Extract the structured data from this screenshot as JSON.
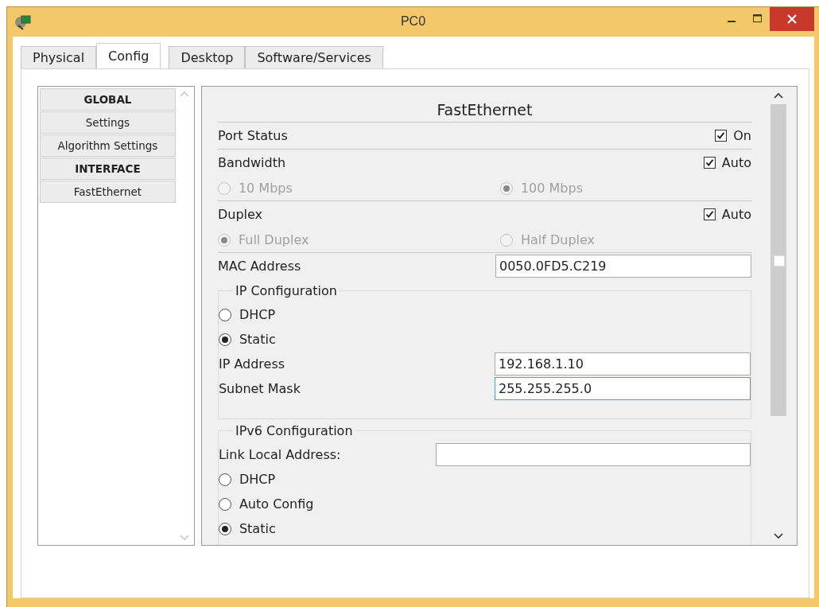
{
  "window": {
    "title": "PC0"
  },
  "tabs": [
    {
      "label": "Physical",
      "selected": false
    },
    {
      "label": "Config",
      "selected": true
    },
    {
      "label": "Desktop",
      "selected": false
    },
    {
      "label": "Software/Services",
      "selected": false
    }
  ],
  "sidebar": {
    "items": [
      {
        "label": "GLOBAL",
        "kind": "header"
      },
      {
        "label": "Settings",
        "kind": "item"
      },
      {
        "label": "Algorithm Settings",
        "kind": "item"
      },
      {
        "label": "INTERFACE",
        "kind": "header"
      },
      {
        "label": "FastEthernet",
        "kind": "item"
      }
    ]
  },
  "panel": {
    "title": "FastEthernet",
    "rows": [
      {
        "kind": "check",
        "label": "Port Status",
        "check_label": "On",
        "checked": true
      },
      {
        "kind": "check",
        "label": "Bandwidth",
        "check_label": "Auto",
        "checked": true
      },
      {
        "kind": "radios",
        "options": [
          {
            "label": "10 Mbps",
            "selected": false,
            "disabled": true
          },
          {
            "label": "100 Mbps",
            "selected": true,
            "disabled": true
          }
        ]
      },
      {
        "kind": "check",
        "label": "Duplex",
        "check_label": "Auto",
        "checked": true
      },
      {
        "kind": "radios",
        "options": [
          {
            "label": "Full Duplex",
            "selected": true,
            "disabled": true
          },
          {
            "label": "Half Duplex",
            "selected": false,
            "disabled": true
          }
        ]
      },
      {
        "kind": "field",
        "label": "MAC Address",
        "value": "0050.0FD5.C219",
        "focused": false
      },
      {
        "kind": "group",
        "title": "IP Configuration",
        "rows": [
          {
            "kind": "radio",
            "label": "DHCP",
            "selected": false
          },
          {
            "kind": "radio",
            "label": "Static",
            "selected": true
          },
          {
            "kind": "field",
            "label": "IP Address",
            "value": "192.168.1.10",
            "focused": false
          },
          {
            "kind": "field",
            "label": "Subnet Mask",
            "value": "255.255.255.0",
            "focused": true
          }
        ]
      },
      {
        "kind": "group",
        "title": "IPv6 Configuration",
        "rows": [
          {
            "kind": "wide_field",
            "label": "Link Local Address:",
            "focused": false
          },
          {
            "kind": "radio",
            "label": "DHCP",
            "selected": false
          },
          {
            "kind": "radio",
            "label": "Auto Config",
            "selected": false
          },
          {
            "kind": "radio",
            "label": "Static",
            "selected": true
          }
        ]
      }
    ]
  }
}
